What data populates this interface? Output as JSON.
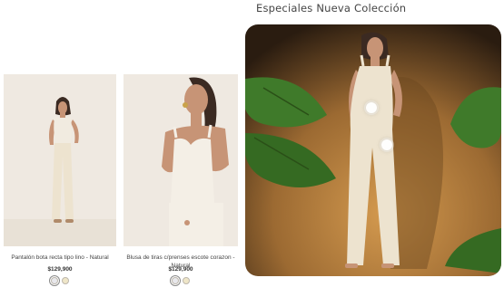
{
  "section": {
    "title": "Especiales Nueva Colección"
  },
  "products": [
    {
      "name": "Pantalón bota recta tipo lino - Natural",
      "price": "$129,900",
      "swatches": [
        {
          "color": "#e8e8ec",
          "selected": true
        },
        {
          "color": "#efe6c8",
          "selected": false
        }
      ]
    },
    {
      "name": "Blusa de tiras c/prenses escote corazon - Natural",
      "price": "$129,900",
      "swatches": [
        {
          "color": "#e8e8ec",
          "selected": true
        },
        {
          "color": "#efe6c8",
          "selected": false
        }
      ]
    }
  ],
  "colors": {
    "card_bg": "#efe9e1",
    "feature_bg_dark": "#2a1c10",
    "feature_bg_light": "#d49a4f",
    "garment": "#ede3cf",
    "leaf": "#3f7a2a",
    "skin": "#c79476",
    "hair": "#3b2a22"
  }
}
